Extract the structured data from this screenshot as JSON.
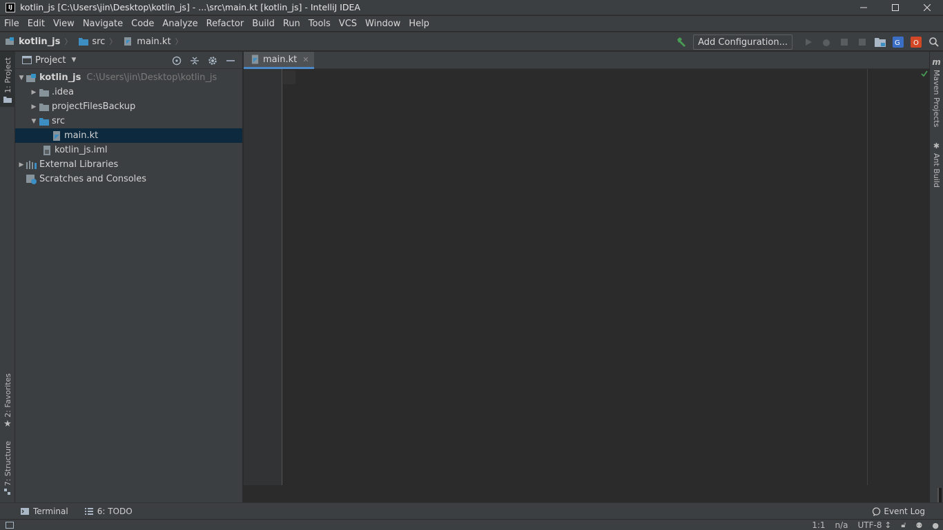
{
  "window": {
    "title": "kotlin_js [C:\\Users\\jin\\Desktop\\kotlin_js] - ...\\src\\main.kt [kotlin_js] - IntelliJ IDEA",
    "app_icon_text": "IJ"
  },
  "menu": [
    "File",
    "Edit",
    "View",
    "Navigate",
    "Code",
    "Analyze",
    "Refactor",
    "Build",
    "Run",
    "Tools",
    "VCS",
    "Window",
    "Help"
  ],
  "breadcrumb": [
    "kotlin_js",
    "src",
    "main.kt"
  ],
  "toolbar": {
    "add_config_label": "Add Configuration..."
  },
  "left_tabs": {
    "project": "1: Project",
    "favorites": "2: Favorites",
    "structure": "7: Structure"
  },
  "right_tabs": {
    "maven": "Maven Projects",
    "ant": "Ant Build"
  },
  "project_panel": {
    "title": "Project",
    "tree": [
      {
        "label": "kotlin_js",
        "path": "C:\\Users\\jin\\Desktop\\kotlin_js"
      },
      {
        "label": ".idea"
      },
      {
        "label": "projectFilesBackup"
      },
      {
        "label": "src"
      },
      {
        "label": "main.kt"
      },
      {
        "label": "kotlin_js.iml"
      },
      {
        "label": "External Libraries"
      },
      {
        "label": "Scratches and Consoles"
      }
    ]
  },
  "editor": {
    "tab_label": "main.kt"
  },
  "bottom_tabs": {
    "terminal": "Terminal",
    "todo": "6: TODO",
    "event_log": "Event Log"
  },
  "status": {
    "position": "1:1",
    "na": "n/a",
    "encoding": "UTF-8 ↕"
  },
  "colors": {
    "accent": "#4a88c7",
    "selection": "#0d293e",
    "check": "#499c54"
  }
}
